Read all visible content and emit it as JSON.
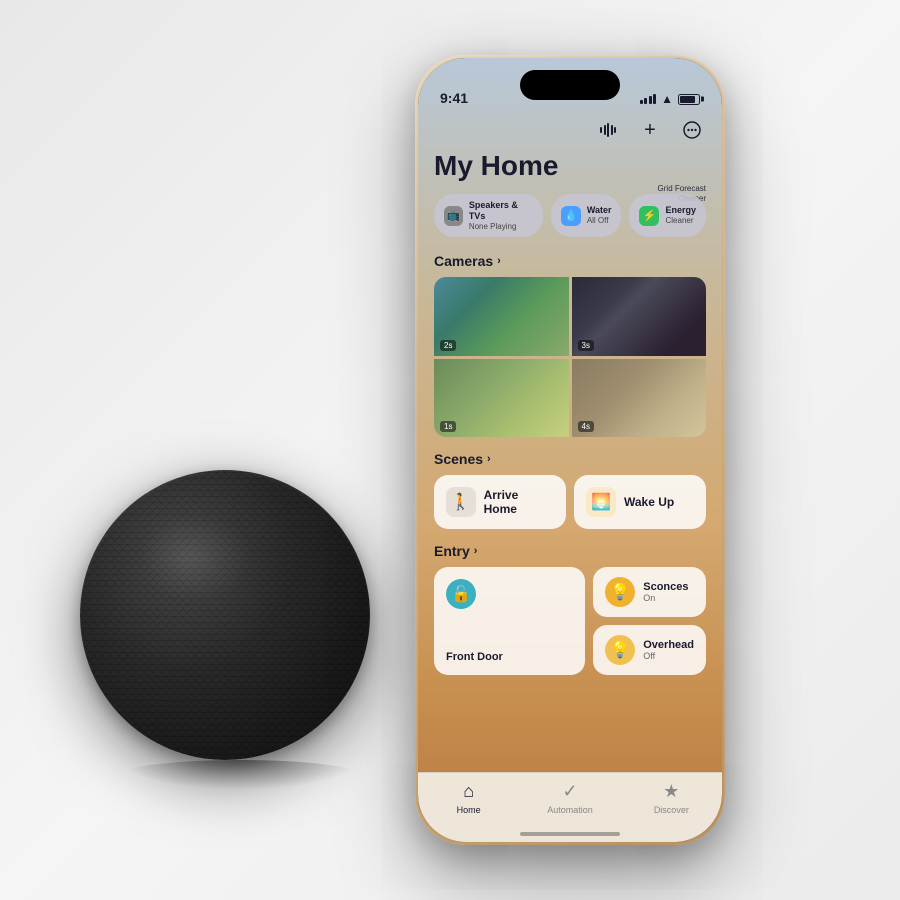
{
  "scene": {
    "background": "#f0f0f0"
  },
  "status_bar": {
    "time": "9:41"
  },
  "header": {
    "title": "My Home",
    "grid_forecast_line1": "Grid Forecast",
    "grid_forecast_line2": "Cleaner"
  },
  "top_controls": {
    "waveform_label": "waveform",
    "add_label": "+",
    "more_label": "•••"
  },
  "pills": [
    {
      "icon": "📺",
      "label": "Speakers & TVs",
      "sublabel": "None Playing",
      "type": "speaker"
    },
    {
      "icon": "💧",
      "label": "Water",
      "sublabel": "All Off",
      "type": "water"
    },
    {
      "icon": "⚡",
      "label": "Energy",
      "sublabel": "Cleaner",
      "type": "energy"
    }
  ],
  "cameras": {
    "section_label": "Cameras",
    "chevron": "›",
    "feeds": [
      {
        "id": 1,
        "timestamp": "2s"
      },
      {
        "id": 2,
        "timestamp": "3s"
      },
      {
        "id": 3,
        "timestamp": "1s"
      },
      {
        "id": 4,
        "timestamp": "4s"
      }
    ]
  },
  "scenes": {
    "section_label": "Scenes",
    "chevron": "›",
    "items": [
      {
        "id": "arrive",
        "label": "Arrive Home",
        "icon": "🚶"
      },
      {
        "id": "wakeup",
        "label": "Wake Up",
        "icon": "🌅"
      }
    ]
  },
  "entry": {
    "section_label": "Entry",
    "chevron": "›",
    "items": [
      {
        "id": "front-door",
        "label": "Front Door",
        "icon": "🔓",
        "type": "unlock"
      },
      {
        "id": "sconces",
        "label": "Sconces",
        "sublabel": "On",
        "icon": "💡",
        "type": "sconces"
      },
      {
        "id": "overhead",
        "label": "Overhead",
        "sublabel": "Off",
        "icon": "💡",
        "type": "overhead"
      }
    ]
  },
  "tab_bar": {
    "tabs": [
      {
        "id": "home",
        "label": "Home",
        "icon": "⌂",
        "active": true
      },
      {
        "id": "automation",
        "label": "Automation",
        "icon": "✓",
        "active": false
      },
      {
        "id": "discover",
        "label": "Discover",
        "icon": "★",
        "active": false
      }
    ]
  }
}
